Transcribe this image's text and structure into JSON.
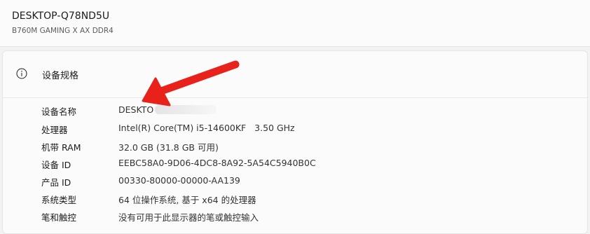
{
  "device": {
    "name": "DESKTOP-Q78ND5U",
    "model": "B760M GAMING X AX DDR4"
  },
  "specs": {
    "title": "设备规格",
    "rows": [
      {
        "label": "设备名称",
        "value": "DESKTO"
      },
      {
        "label": "处理器",
        "value": "Intel(R) Core(TM) i5-14600KF   3.50 GHz"
      },
      {
        "label": "机带 RAM",
        "value": "32.0 GB (31.8 GB 可用)"
      },
      {
        "label": "设备 ID",
        "value": "EEBC58A0-9D06-4DC8-8A92-5A54C5940B0C"
      },
      {
        "label": "产品 ID",
        "value": "00330-80000-00000-AA139"
      },
      {
        "label": "系统类型",
        "value": "64 位操作系统, 基于 x64 的处理器"
      },
      {
        "label": "笔和触控",
        "value": "没有可用于此显示器的笔或触控输入"
      }
    ]
  },
  "icons": {
    "spec_header": "info-icon",
    "annotation": "red-arrow-icon"
  },
  "colors": {
    "annotation_arrow": "#e8221b"
  }
}
